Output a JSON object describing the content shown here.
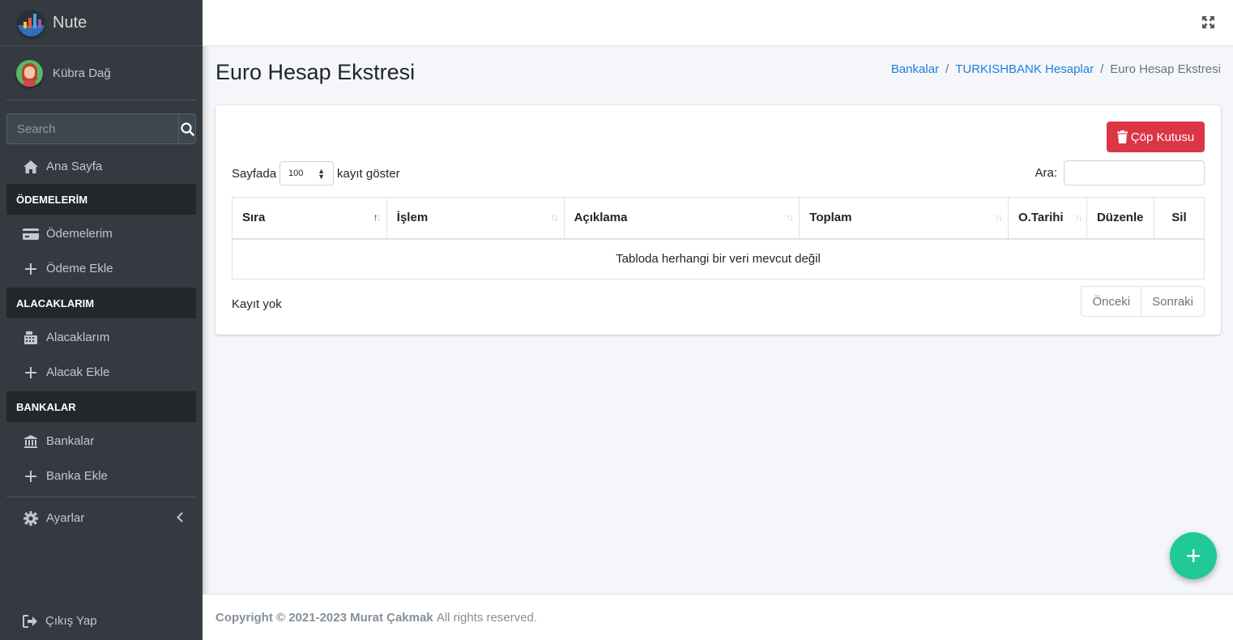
{
  "brand": {
    "name": "Nute"
  },
  "user": {
    "name": "Kübra Dağ"
  },
  "search": {
    "placeholder": "Search"
  },
  "sidebar": {
    "home": "Ana Sayfa",
    "header_payments": "ÖDEMELERİM",
    "payments": "Ödemelerim",
    "add_payment": "Ödeme Ekle",
    "header_receivables": "ALACAKLARIM",
    "receivables": "Alacaklarım",
    "add_receivable": "Alacak Ekle",
    "header_banks": "BANKALAR",
    "banks": "Bankalar",
    "add_bank": "Banka Ekle",
    "settings": "Ayarlar",
    "logout": "Çıkış Yap"
  },
  "page": {
    "title": "Euro Hesap Ekstresi",
    "breadcrumb": [
      "Bankalar",
      "TURKISHBANK Hesaplar",
      "Euro Hesap Ekstresi"
    ]
  },
  "toolbar": {
    "trash_label": "Çöp Kutusu"
  },
  "table_controls": {
    "length_prefix": "Sayfada",
    "length_value": "100",
    "length_suffix": "kayıt göster",
    "filter_label": "Ara:"
  },
  "table": {
    "columns": [
      "Sıra",
      "İşlem",
      "Açıklama",
      "Toplam",
      "O.Tarihi",
      "Düzenle",
      "Sil"
    ],
    "empty_text": "Tabloda herhangi bir veri mevcut değil"
  },
  "pagination": {
    "info": "Kayıt yok",
    "prev": "Önceki",
    "next": "Sonraki"
  },
  "footer": {
    "copyright": "Copyright © 2021-2023 Murat Çakmak",
    "rights": "All rights reserved."
  },
  "colors": {
    "sidebar_bg": "#343a40",
    "danger": "#dc3545",
    "fab": "#20c997",
    "link": "#1e7fdd"
  }
}
